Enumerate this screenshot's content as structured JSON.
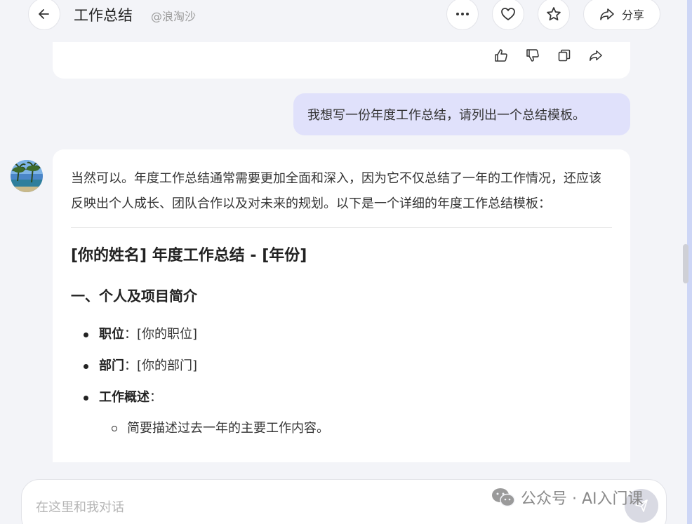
{
  "header": {
    "title": "工作总结",
    "handle": "@浪淘沙",
    "share_label": "分享",
    "icons": [
      "back-arrow-icon",
      "more-icon",
      "heart-icon",
      "star-icon",
      "share-icon"
    ]
  },
  "prev_actions": [
    "thumbs-up-icon",
    "thumbs-down-icon",
    "copy-icon",
    "forward-icon"
  ],
  "user_message": "我想写一份年度工作总结，请列出一个总结模板。",
  "reply": {
    "intro": "当然可以。年度工作总结通常需要更加全面和深入，因为它不仅总结了一年的工作情况，还应该反映出个人成长、团队合作以及对未来的规划。以下是一个详细的年度工作总结模板：",
    "heading1": "[你的姓名] 年度工作总结 - [年份]",
    "heading2": "一、个人及项目简介",
    "items": [
      {
        "label": "职位",
        "sep": "：",
        "value": "[你的职位]"
      },
      {
        "label": "部门",
        "sep": "：",
        "value": "[你的部门]"
      },
      {
        "label": "工作概述",
        "sep": "：",
        "value": ""
      }
    ],
    "sub_items": [
      "简要描述过去一年的主要工作内容。"
    ]
  },
  "input": {
    "placeholder": "在这里和我对话"
  },
  "watermark": "公众号 · AI入门课",
  "colors": {
    "background": "#f3f4f8",
    "user_bubble": "#e0e1fb",
    "card": "#ffffff"
  }
}
